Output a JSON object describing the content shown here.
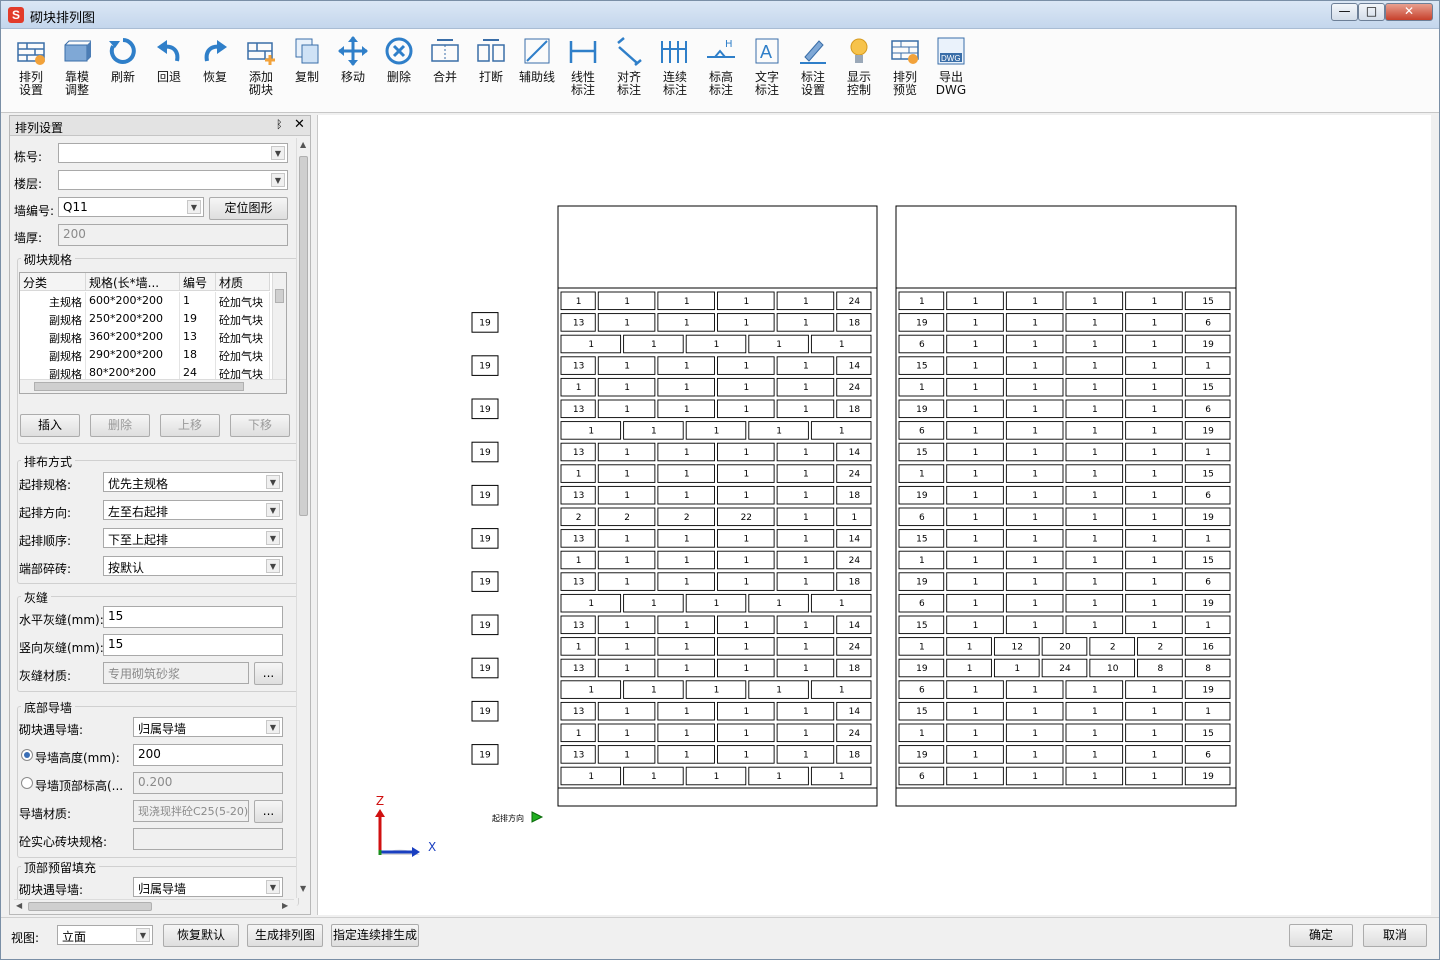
{
  "window": {
    "title": "砌块排列图",
    "app_icon_letter": "S",
    "controls": {
      "minimize": "—",
      "maximize": "□",
      "close": "✕"
    }
  },
  "toolbar": [
    {
      "label": "排列\n设置",
      "icon": "arrange-settings-icon"
    },
    {
      "label": "靠模\n调整",
      "icon": "mold-adjust-icon"
    },
    {
      "label": "刷新",
      "icon": "refresh-icon"
    },
    {
      "label": "回退",
      "icon": "undo-icon"
    },
    {
      "label": "恢复",
      "icon": "redo-icon"
    },
    {
      "label": "添加\n砌块",
      "icon": "add-block-icon"
    },
    {
      "label": "复制",
      "icon": "copy-icon"
    },
    {
      "label": "移动",
      "icon": "move-icon"
    },
    {
      "label": "删除",
      "icon": "delete-icon"
    },
    {
      "label": "合并",
      "icon": "merge-icon"
    },
    {
      "label": "打断",
      "icon": "break-icon"
    },
    {
      "label": "辅助线",
      "icon": "guide-line-icon"
    },
    {
      "label": "线性\n标注",
      "icon": "linear-dim-icon"
    },
    {
      "label": "对齐\n标注",
      "icon": "aligned-dim-icon"
    },
    {
      "label": "连续\n标注",
      "icon": "continuous-dim-icon"
    },
    {
      "label": "标高\n标注",
      "icon": "elevation-dim-icon"
    },
    {
      "label": "文字\n标注",
      "icon": "text-dim-icon"
    },
    {
      "label": "标注\n设置",
      "icon": "dim-settings-icon"
    },
    {
      "label": "显示\n控制",
      "icon": "display-control-icon"
    },
    {
      "label": "排列\n预览",
      "icon": "arrange-preview-icon"
    },
    {
      "label": "导出\nDWG",
      "icon": "export-dwg-icon"
    }
  ],
  "panel": {
    "title": "排列设置",
    "pin": "ᛒ",
    "close": "✕",
    "building_label": "栋号:",
    "building_value": "",
    "floor_label": "楼层:",
    "floor_value": "",
    "wall_id_label": "墙编号:",
    "wall_id_value": "Q11",
    "locate_button": "定位图形",
    "wall_thickness_label": "墙厚:",
    "wall_thickness_value": "200",
    "spec_group_title": "砌块规格",
    "spec_columns": [
      "分类",
      "规格(长*墙...",
      "编号",
      "材质"
    ],
    "spec_rows": [
      [
        "主规格",
        "600*200*200",
        "1",
        "砼加气块"
      ],
      [
        "副规格",
        "250*200*200",
        "19",
        "砼加气块"
      ],
      [
        "副规格",
        "360*200*200",
        "13",
        "砼加气块"
      ],
      [
        "副规格",
        "290*200*200",
        "18",
        "砼加气块"
      ],
      [
        "副规格",
        "80*200*200",
        "24",
        "砼加气块"
      ],
      [
        "副规格",
        "350*200*200",
        "14",
        "砼加气块"
      ]
    ],
    "spec_buttons": {
      "insert": "插入",
      "delete": "删除",
      "up": "上移",
      "down": "下移"
    },
    "layout_group_title": "排布方式",
    "start_spec_label": "起排规格:",
    "start_spec_value": "优先主规格",
    "start_dir_label": "起排方向:",
    "start_dir_value": "左至右起排",
    "start_order_label": "起排顺序:",
    "start_order_value": "下至上起排",
    "end_brick_label": "端部碎砖:",
    "end_brick_value": "按默认",
    "joint_group_title": "灰缝",
    "h_joint_label": "水平灰缝(mm):",
    "h_joint_value": "15",
    "v_joint_label": "竖向灰缝(mm):",
    "v_joint_value": "15",
    "joint_material_label": "灰缝材质:",
    "joint_material_value": "专用砌筑砂浆",
    "ellipsis": "...",
    "bottom_group_title": "底部导墙",
    "guide_meet_label": "砌块遇导墙:",
    "guide_meet_value": "归属导墙",
    "guide_height_label": "导墙高度(mm):",
    "guide_height_value": "200",
    "guide_top_label": "导墙顶部标高(...",
    "guide_top_value": "0.200",
    "guide_material_label": "导墙材质:",
    "guide_material_value": "现浇现拌砼C25(5-20)",
    "solid_brick_label": "砼实心砖块规格:",
    "solid_brick_value": "",
    "top_group_title": "顶部预留填充",
    "top_guide_meet_label": "砌块遇导墙:",
    "top_guide_meet_value": "归属导墙"
  },
  "canvas": {
    "axis_z": "Z",
    "axis_x": "X",
    "start_dir_text": "起排方向",
    "left_markers": [
      "19",
      "19",
      "19",
      "19",
      "19",
      "19",
      "19",
      "19",
      "19",
      "19",
      "19"
    ],
    "left_wall_rows": [
      [
        "1",
        "1",
        "1",
        "1",
        "1",
        "24"
      ],
      [
        "13",
        "1",
        "1",
        "1",
        "1",
        "18"
      ],
      [
        "1",
        "1",
        "1",
        "1",
        "1"
      ],
      [
        "13",
        "1",
        "1",
        "1",
        "1",
        "14"
      ],
      [
        "1",
        "1",
        "1",
        "1",
        "1",
        "24"
      ],
      [
        "13",
        "1",
        "1",
        "1",
        "1",
        "18"
      ],
      [
        "1",
        "1",
        "1",
        "1",
        "1"
      ],
      [
        "13",
        "1",
        "1",
        "1",
        "1",
        "14"
      ],
      [
        "1",
        "1",
        "1",
        "1",
        "1",
        "24"
      ],
      [
        "13",
        "1",
        "1",
        "1",
        "1",
        "18"
      ],
      [
        "2",
        "2",
        "2",
        "22",
        "1",
        "1"
      ],
      [
        "13",
        "1",
        "1",
        "1",
        "1",
        "14"
      ],
      [
        "1",
        "1",
        "1",
        "1",
        "1",
        "24"
      ],
      [
        "13",
        "1",
        "1",
        "1",
        "1",
        "18"
      ],
      [
        "1",
        "1",
        "1",
        "1",
        "1"
      ],
      [
        "13",
        "1",
        "1",
        "1",
        "1",
        "14"
      ],
      [
        "1",
        "1",
        "1",
        "1",
        "1",
        "24"
      ],
      [
        "13",
        "1",
        "1",
        "1",
        "1",
        "18"
      ],
      [
        "1",
        "1",
        "1",
        "1",
        "1"
      ],
      [
        "13",
        "1",
        "1",
        "1",
        "1",
        "14"
      ],
      [
        "1",
        "1",
        "1",
        "1",
        "1",
        "24"
      ],
      [
        "13",
        "1",
        "1",
        "1",
        "1",
        "18"
      ],
      [
        "1",
        "1",
        "1",
        "1",
        "1"
      ]
    ],
    "right_wall_rows": [
      [
        "1",
        "1",
        "1",
        "1",
        "1",
        "15"
      ],
      [
        "19",
        "1",
        "1",
        "1",
        "1",
        "6"
      ],
      [
        "6",
        "1",
        "1",
        "1",
        "1",
        "19"
      ],
      [
        "15",
        "1",
        "1",
        "1",
        "1",
        "1"
      ],
      [
        "1",
        "1",
        "1",
        "1",
        "1",
        "15"
      ],
      [
        "19",
        "1",
        "1",
        "1",
        "1",
        "6"
      ],
      [
        "6",
        "1",
        "1",
        "1",
        "1",
        "19"
      ],
      [
        "15",
        "1",
        "1",
        "1",
        "1",
        "1"
      ],
      [
        "1",
        "1",
        "1",
        "1",
        "1",
        "15"
      ],
      [
        "19",
        "1",
        "1",
        "1",
        "1",
        "6"
      ],
      [
        "6",
        "1",
        "1",
        "1",
        "1",
        "19"
      ],
      [
        "15",
        "1",
        "1",
        "1",
        "1",
        "1"
      ],
      [
        "1",
        "1",
        "1",
        "1",
        "1",
        "15"
      ],
      [
        "19",
        "1",
        "1",
        "1",
        "1",
        "6"
      ],
      [
        "6",
        "1",
        "1",
        "1",
        "1",
        "19"
      ],
      [
        "15",
        "1",
        "1",
        "1",
        "1",
        "1"
      ],
      [
        "1",
        "1",
        "12",
        "20",
        "2",
        "2",
        "16"
      ],
      [
        "19",
        "1",
        "1",
        "24",
        "10",
        "8",
        "8"
      ],
      [
        "6",
        "1",
        "1",
        "1",
        "1",
        "19"
      ],
      [
        "15",
        "1",
        "1",
        "1",
        "1",
        "1"
      ],
      [
        "1",
        "1",
        "1",
        "1",
        "1",
        "15"
      ],
      [
        "19",
        "1",
        "1",
        "1",
        "1",
        "6"
      ],
      [
        "6",
        "1",
        "1",
        "1",
        "1",
        "19"
      ]
    ]
  },
  "bottom": {
    "view_label": "视图:",
    "view_value": "立面",
    "restore_button": "恢复默认",
    "generate_button": "生成排列图",
    "continuous_button": "指定连续排生成",
    "ok_button": "确定",
    "cancel_button": "取消"
  }
}
